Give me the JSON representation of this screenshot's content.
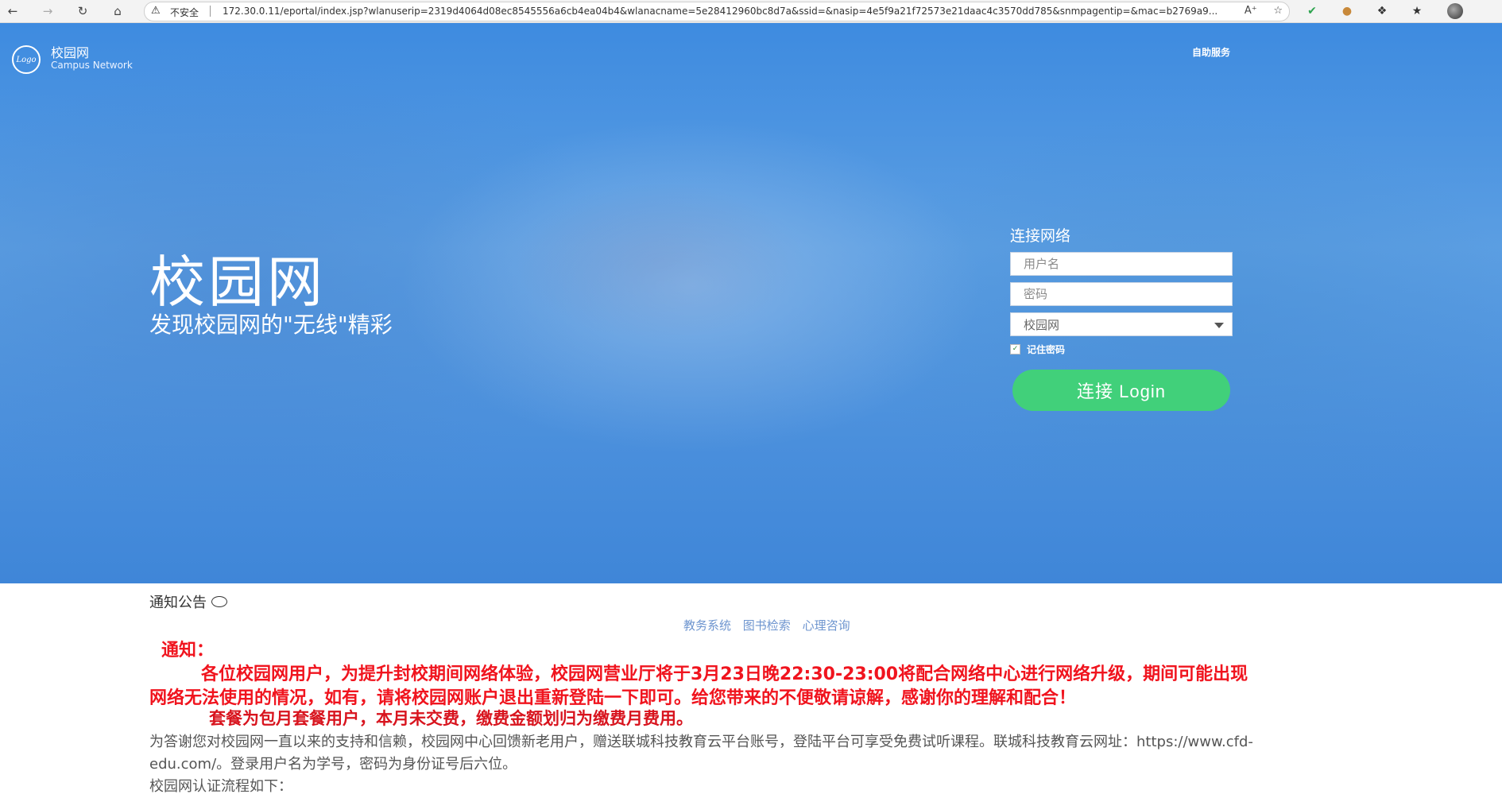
{
  "browser": {
    "insecure_label": "不安全",
    "url": "172.30.0.11/eportal/index.jsp?wlanuserip=2319d4064d08ec8545556a6cb4ea04b4&wlanacname=5e28412960bc8d7a&ssid=&nasip=4e5f9a21f72573e21daac4c3570dd785&snmpagentip=&mac=b2769a9..."
  },
  "header": {
    "logo_text": "Logo",
    "title": "校园网",
    "subtitle": "Campus Network",
    "self_service": "自助服务"
  },
  "hero": {
    "title": "校园网",
    "slogan": "发现校园网的\"无线\"精彩"
  },
  "login": {
    "title": "连接网络",
    "username_placeholder": "用户名",
    "password_placeholder": "密码",
    "service_selected": "校园网",
    "remember_label": "记住密码",
    "remember_checked": true,
    "button_label": "连接 Login"
  },
  "notice": {
    "header": "通知公告",
    "links": [
      "教务系统",
      "图书检索",
      "心理咨询"
    ],
    "title": "通知：",
    "line1": "各位校园网用户，为提升封校期间网络体验，校园网营业厅将于3月23日晚22:30-23:00将配合网络中心进行网络升级，期间可能出现",
    "line2": "网络无法使用的情况，如有，请将校园网账户退出重新登陆一下即可。给您带来的不便敬请谅解，感谢你的理解和配合！",
    "line3": "套餐为包月套餐用户，本月未交费，缴费金额划归为缴费月费用。",
    "body1": "为答谢您对校园网一直以来的支持和信赖，校园网中心回馈新老用户，赠送联城科技教育云平台账号，登陆平台可享受免费试听课程。联城科技教育云网址：https://www.cfd-edu.com/。登录用户名为学号，密码为身份证号后六位。",
    "body2": "校园网认证流程如下："
  }
}
